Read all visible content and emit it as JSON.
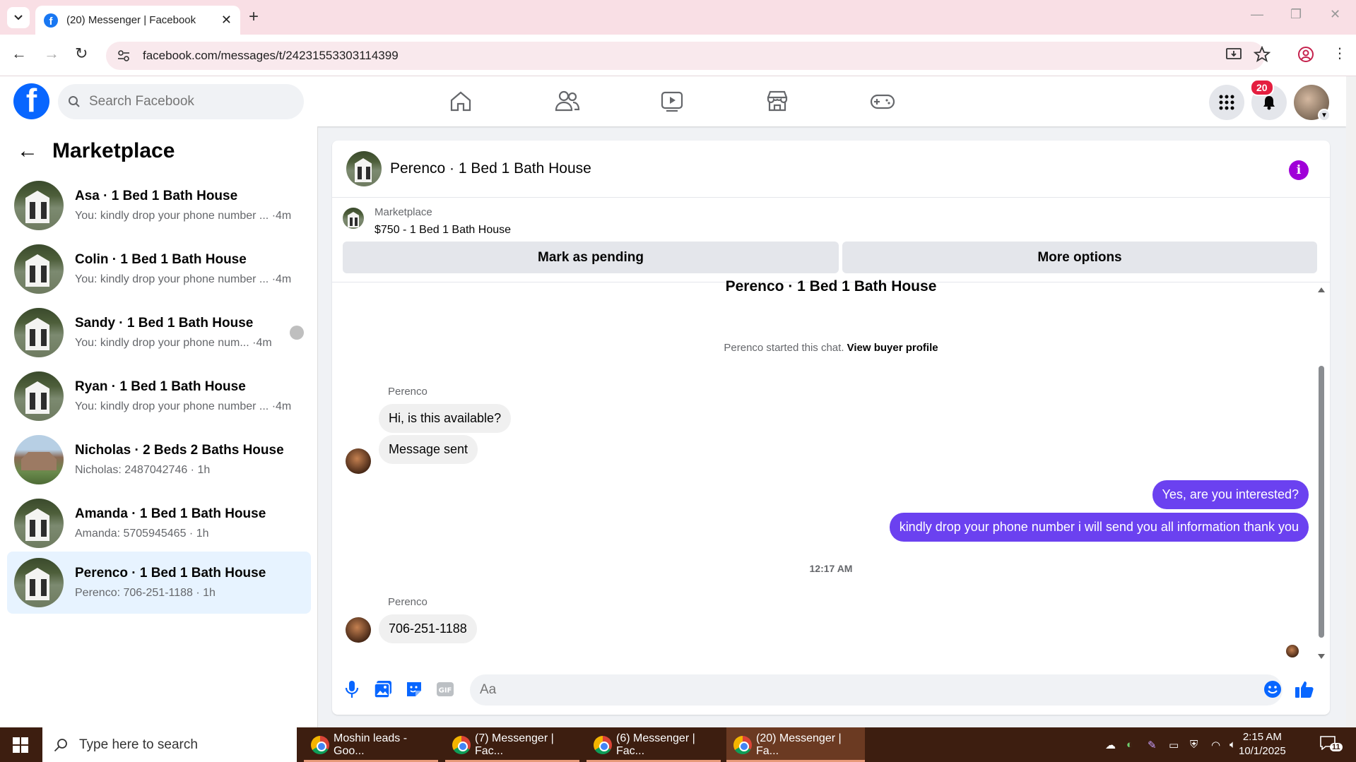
{
  "browser": {
    "tab_title": "(20) Messenger | Facebook",
    "url": "facebook.com/messages/t/24231553303114399"
  },
  "facebook": {
    "search_placeholder": "Search Facebook",
    "notification_count": "20",
    "brand_color": "#0866ff"
  },
  "sidebar": {
    "title": "Marketplace",
    "conversations": [
      {
        "name": "Asa · 1 Bed 1 Bath House",
        "preview": "You: kindly drop your phone number ... ·4m"
      },
      {
        "name": "Colin · 1 Bed 1 Bath House",
        "preview": "You: kindly drop your phone number ... ·4m"
      },
      {
        "name": "Sandy · 1 Bed 1 Bath House",
        "preview": "You: kindly drop your phone num... ·4m"
      },
      {
        "name": "Ryan · 1 Bed 1 Bath House",
        "preview": "You: kindly drop your phone number ... ·4m"
      },
      {
        "name": "Nicholas · 2 Beds 2 Baths House",
        "preview": "Nicholas: 2487042746 · 1h"
      },
      {
        "name": "Amanda · 1 Bed 1 Bath House",
        "preview": "Amanda: 5705945465 · 1h"
      },
      {
        "name": "Perenco · 1 Bed 1 Bath House",
        "preview": "Perenco: 706-251-1188 · 1h"
      }
    ]
  },
  "chat": {
    "header_name": "Perenco · 1 Bed 1 Bath House",
    "listing_source": "Marketplace",
    "listing_price": "$750 - 1 Bed 1 Bath House",
    "mark_pending_label": "Mark as pending",
    "more_options_label": "More options",
    "thread_title": "Perenco · 1 Bed 1 Bath House",
    "system_text": "Perenco started this chat.",
    "system_link": "View buyer profile",
    "sender_name": "Perenco",
    "messages": [
      "Hi, is this available?",
      "Message sent",
      "Yes, are you interested?",
      "kindly drop your phone number i will send you all information thank you",
      "706-251-1188"
    ],
    "timestamp": "12:17 AM",
    "input_placeholder": "Aa",
    "outgoing_color": "#6b41f0"
  },
  "taskbar": {
    "search_placeholder": "Type here to search",
    "apps": [
      "Moshin leads - Goo...",
      "(7) Messenger | Fac...",
      "(6) Messenger | Fac...",
      "(20) Messenger | Fa..."
    ],
    "time": "2:15 AM",
    "date": "10/1/2025",
    "notification_count": "11"
  }
}
